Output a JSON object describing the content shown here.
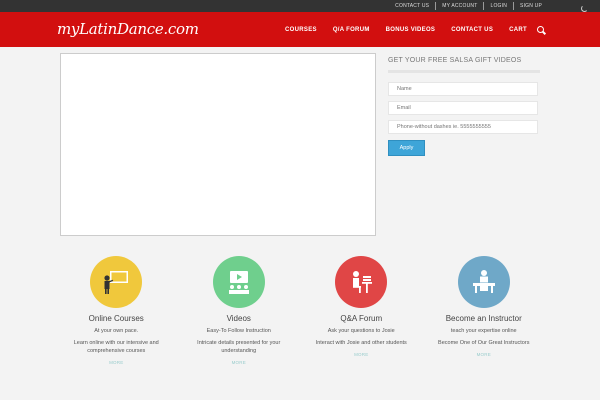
{
  "topbar": {
    "links": [
      "CONTACT US",
      "MY ACCOUNT",
      "LOGIN",
      "SIGN UP"
    ]
  },
  "header": {
    "logo": "myLatinDance.com",
    "nav": [
      "COURSES",
      "Q/A FORUM",
      "BONUS VIDEOS",
      "CONTACT US",
      "CART"
    ]
  },
  "form": {
    "title": "GET YOUR FREE SALSA GIFT VIDEOS",
    "name_placeholder": "Name",
    "email_placeholder": "Email",
    "phone_placeholder": "Phone-without dashes ie. 5555555555",
    "apply_label": "Apply"
  },
  "features": [
    {
      "title": "Online Courses",
      "subtitle": "At your own pace.",
      "description": "Learn online with our intensive and comprehensive courses",
      "more": "MORE",
      "color": "#f0c83c",
      "icon": "teacher-board-icon"
    },
    {
      "title": "Videos",
      "subtitle": "Easy-To Follow Instruction",
      "description": "Intricate details presented for your understanding",
      "more": "MORE",
      "color": "#6fcf8d",
      "icon": "video-class-icon"
    },
    {
      "title": "Q&A Forum",
      "subtitle": "Ask your questions to Josie",
      "description": "Interact with Josie and other students",
      "more": "MORE",
      "color": "#e04646",
      "icon": "student-reading-icon"
    },
    {
      "title": "Become an Instructor",
      "subtitle": "teach your expertise online",
      "description": "Become One of Our Great Instructors",
      "more": "MORE",
      "color": "#6fa8c8",
      "icon": "instructor-desk-icon"
    }
  ]
}
